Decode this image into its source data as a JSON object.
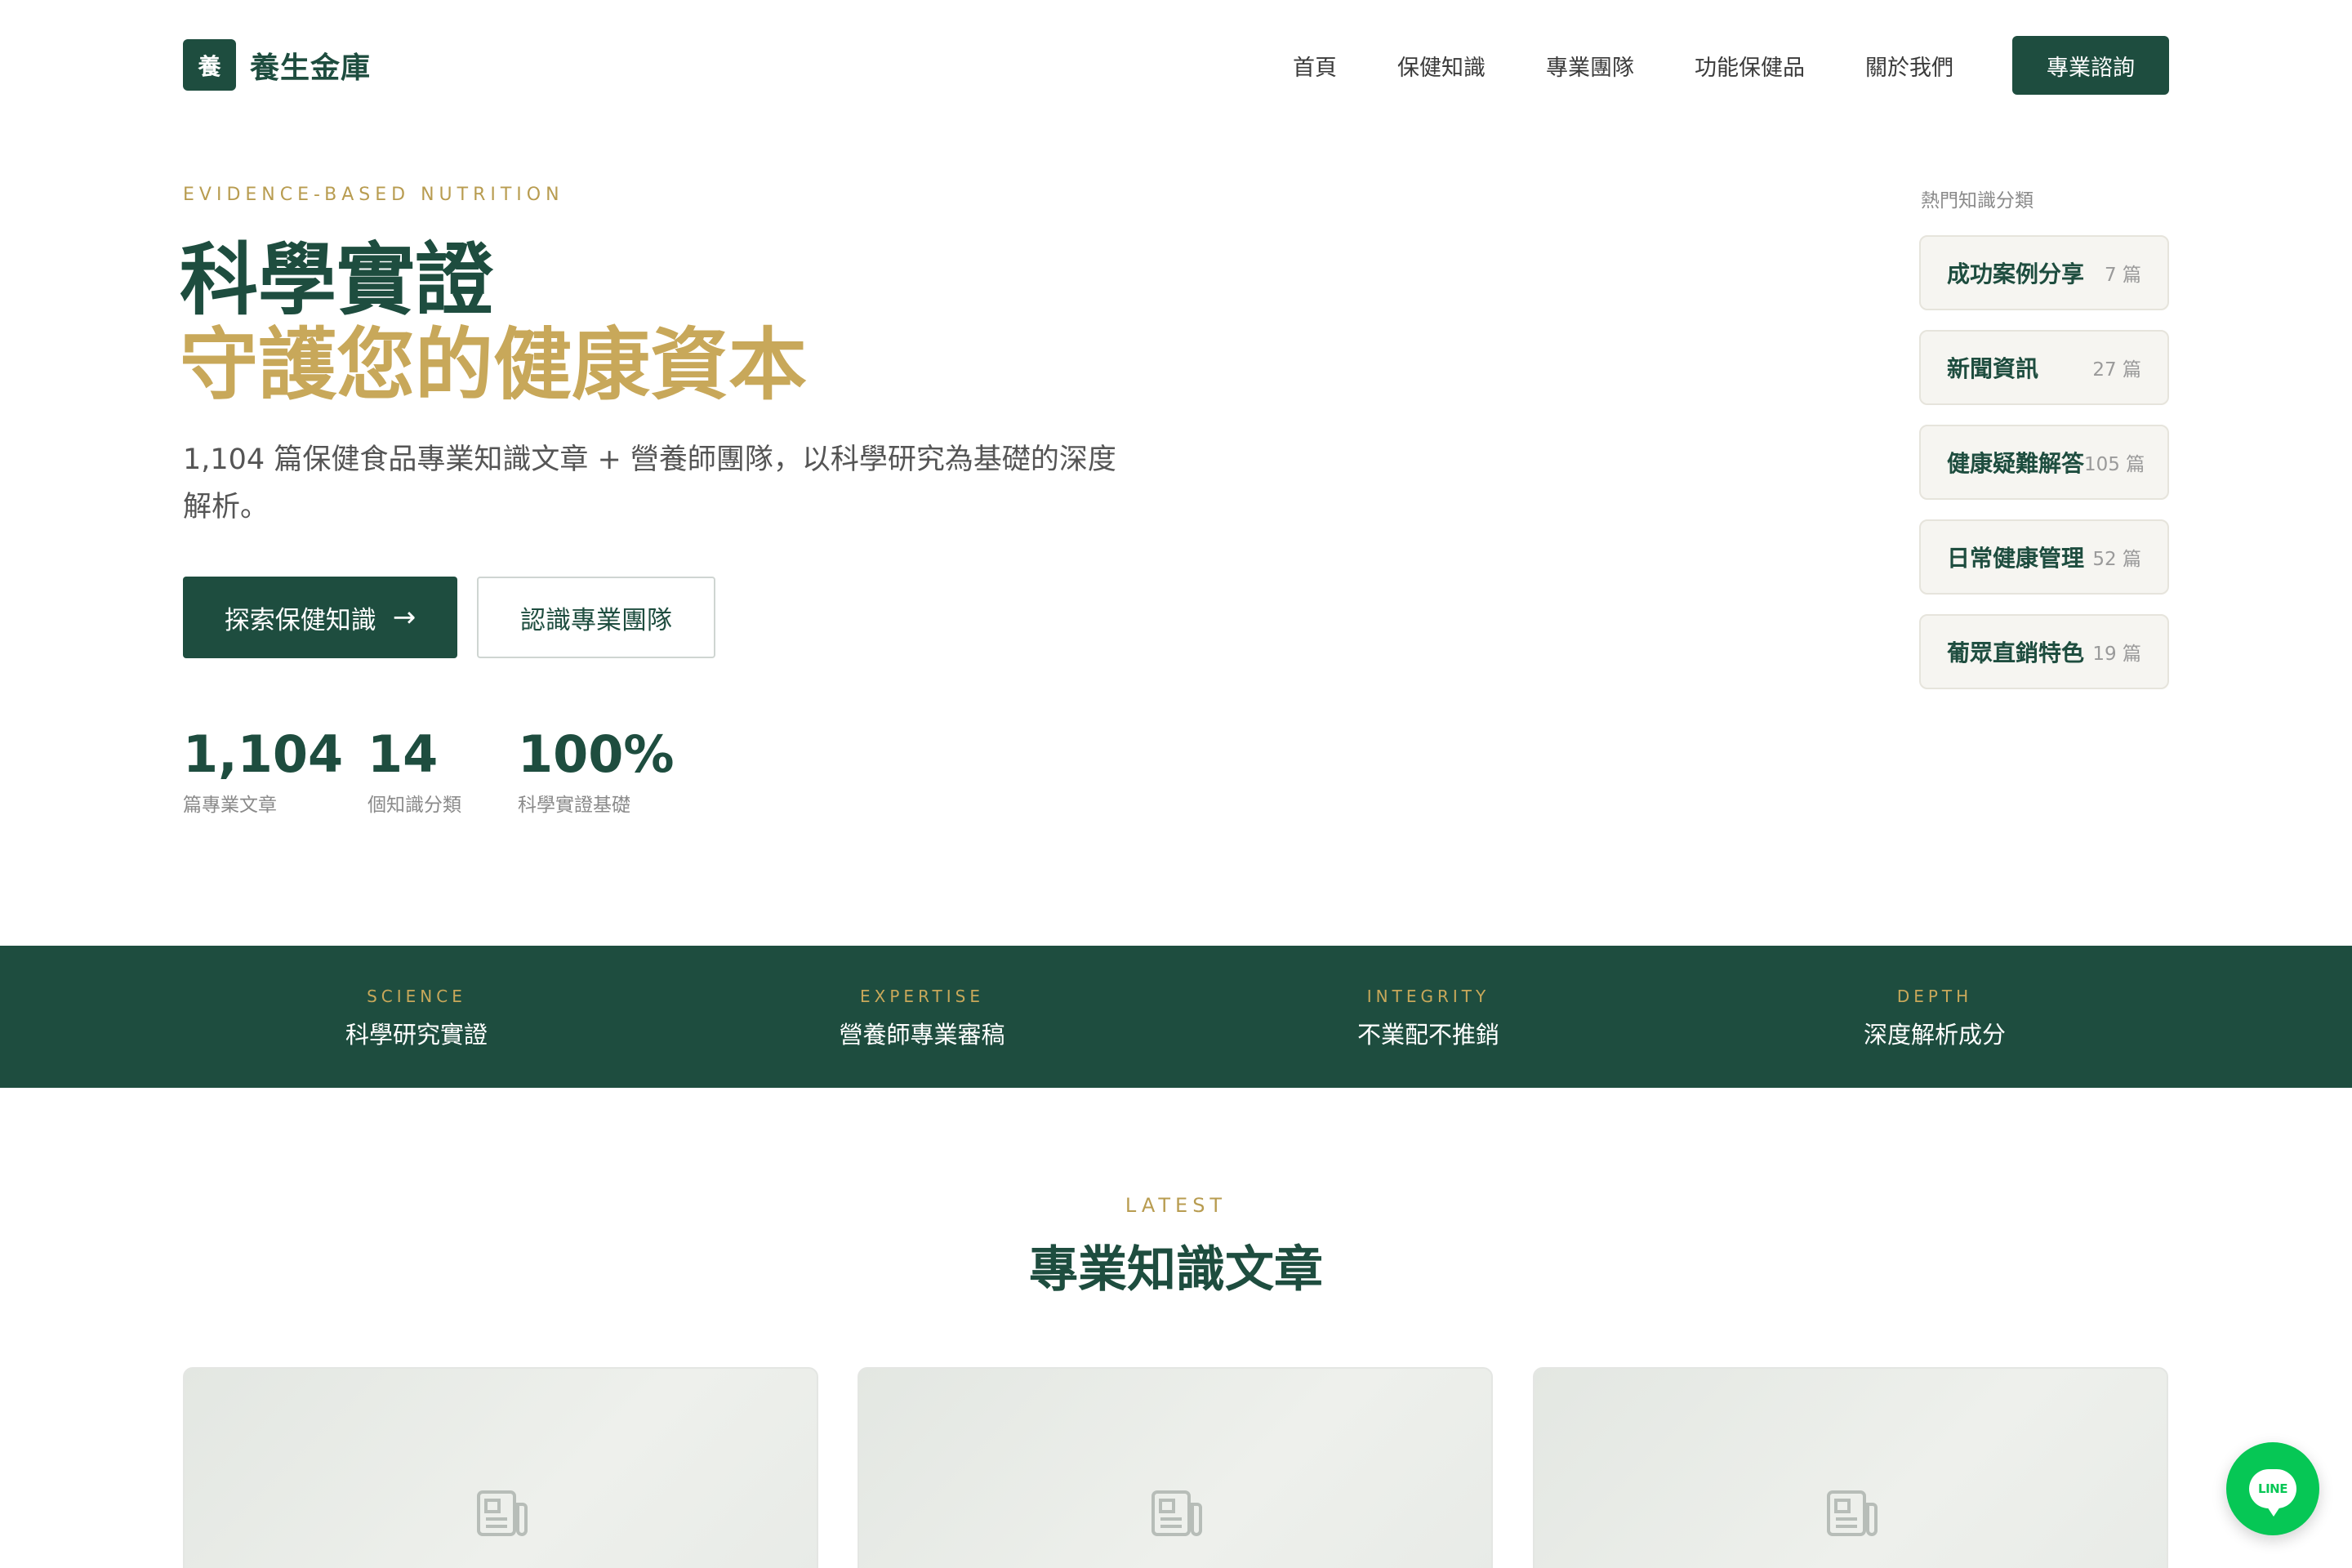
{
  "brand": {
    "mark": "養",
    "name": "養生金庫",
    "primary_color": "#1e4d3f",
    "accent_color": "#c8a85a"
  },
  "nav": {
    "items": [
      "首頁",
      "保健知識",
      "專業團隊",
      "功能保健品",
      "關於我們"
    ],
    "cta": "專業諮詢"
  },
  "hero": {
    "eyebrow": "EVIDENCE-BASED NUTRITION",
    "title_line1": "科學實證",
    "title_line2": "守護您的健康資本",
    "description": "1,104 篇保健食品專業知識文章 + 營養師團隊，以科學研究為基礎的深度解析。",
    "primary_button": "探索保健知識",
    "primary_button_arrow": "→",
    "secondary_button": "認識專業團隊",
    "stats": [
      {
        "value": "1,104",
        "label": "篇專業文章"
      },
      {
        "value": "14",
        "label": "個知識分類"
      },
      {
        "value": "100%",
        "label": "科學實證基礎"
      }
    ]
  },
  "categories": {
    "heading": "熱門知識分類",
    "items": [
      {
        "name": "成功案例分享",
        "count": "7 篇"
      },
      {
        "name": "新聞資訊",
        "count": "27 篇"
      },
      {
        "name": "健康疑難解答",
        "count": "105 篇"
      },
      {
        "name": "日常健康管理",
        "count": "52 篇"
      },
      {
        "name": "葡眾直銷特色",
        "count": "19 篇"
      }
    ]
  },
  "values": [
    {
      "en": "SCIENCE",
      "zh": "科學研究實證"
    },
    {
      "en": "EXPERTISE",
      "zh": "營養師專業審稿"
    },
    {
      "en": "INTEGRITY",
      "zh": "不業配不推銷"
    },
    {
      "en": "DEPTH",
      "zh": "深度解析成分"
    }
  ],
  "latest": {
    "eyebrow": "LATEST",
    "title": "專業知識文章",
    "cards": [
      {
        "icon": "newspaper-icon"
      },
      {
        "icon": "newspaper-icon"
      },
      {
        "icon": "newspaper-icon"
      }
    ]
  },
  "floating": {
    "line_label": "LINE",
    "line_color": "#06c755"
  }
}
